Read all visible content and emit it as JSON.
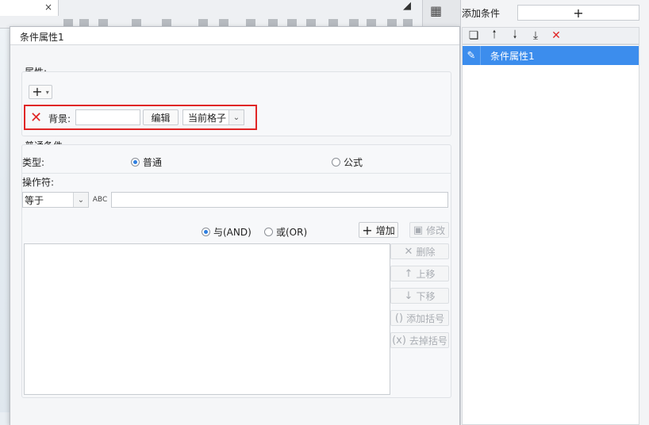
{
  "dialog": {
    "title": "条件属性1",
    "attributes_label": "属性:",
    "background_label": "背景:",
    "background_value": "",
    "edit_button": "编辑",
    "scope_select": "当前格子",
    "normal_condition_label": "普通条件",
    "type_label": "类型:",
    "type_options": {
      "normal": "普通",
      "formula": "公式",
      "selected": "普通"
    },
    "operator_label": "操作符:",
    "operator_select": "等于",
    "value_input": "",
    "logic": {
      "and": "与(AND)",
      "or": "或(OR)",
      "selected": "与(AND)"
    },
    "add_button": "增加",
    "modify_button": "修改",
    "delete_button": "删除",
    "move_up_button": "上移",
    "move_down_button": "下移",
    "add_bracket_button": "添加括号",
    "remove_bracket_button": "去掉括号"
  },
  "right_panel": {
    "title": "添加条件",
    "add_symbol": "+",
    "items": [
      {
        "label": "条件属性1",
        "selected": true
      }
    ]
  },
  "background_app": {
    "tab_close": "×"
  },
  "colors": {
    "accent": "#3c8ded",
    "highlight": "#e02626",
    "radio": "#2f7fe0"
  }
}
